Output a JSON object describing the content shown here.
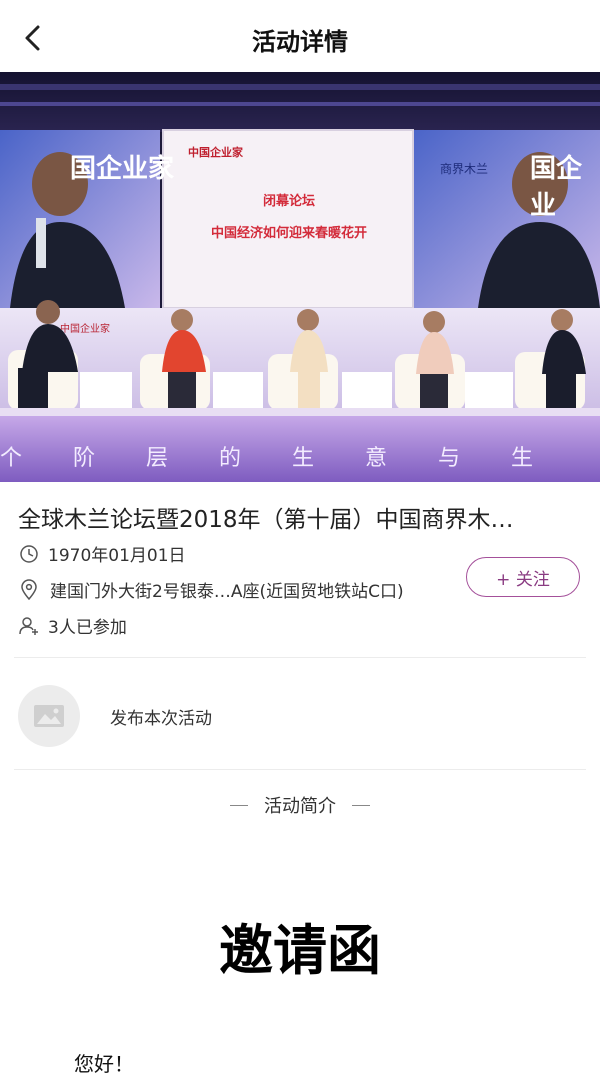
{
  "navbar": {
    "title": "活动详情",
    "back_icon": "chevron-left-icon"
  },
  "hero": {
    "screen_brand": "中国企业家",
    "screen_line1": "闭幕论坛",
    "screen_line2": "中国经济如何迎来春暖花开",
    "side_brand_left": "国企业家",
    "side_brand_right": "国企业",
    "anniversary": "商界木兰",
    "floor_text": "个 阶 层 的 生 意 与 生",
    "stage_brand": "中国企业家"
  },
  "event": {
    "title": "全球木兰论坛暨2018年（第十届）中国商界木…",
    "date": "1970年01月01日",
    "address": "建国门外大街2号银泰…A座(近国贸地铁站C口)",
    "participants": "3人已参加",
    "follow_label": "+ 关注"
  },
  "publish": {
    "label": "发布本次活动",
    "avatar_icon": "image-placeholder-icon"
  },
  "intro": {
    "section_title": "活动简介",
    "heading": "邀请函",
    "greeting": "您好！"
  },
  "colors": {
    "accent": "#a4509a",
    "divider": "#ececec"
  }
}
